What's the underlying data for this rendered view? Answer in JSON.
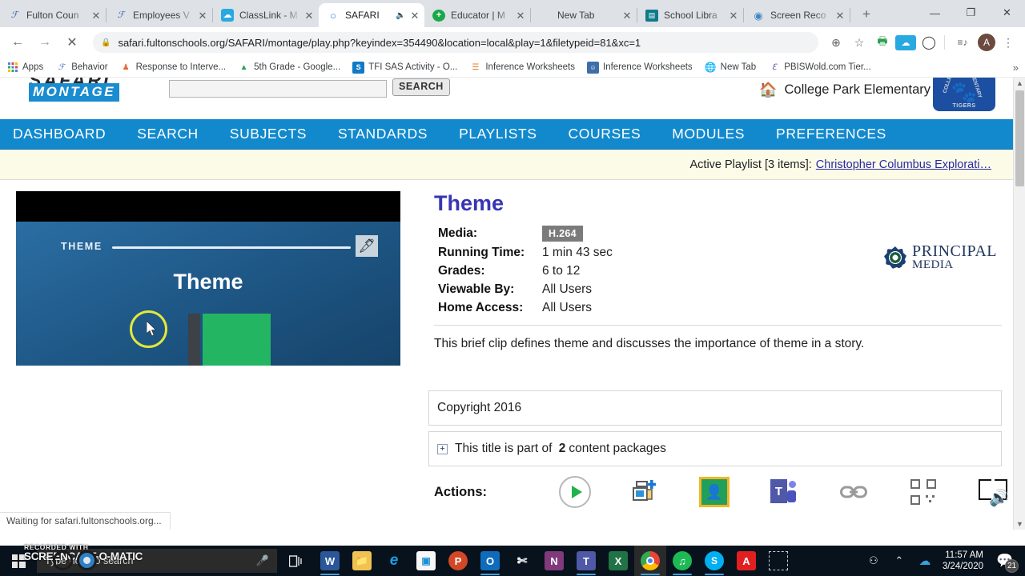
{
  "browser": {
    "tabs": [
      {
        "title": "Fulton Coun",
        "favicon": "script-F",
        "active": false,
        "audio": false
      },
      {
        "title": "Employees V",
        "favicon": "script-F",
        "active": false,
        "audio": false
      },
      {
        "title": "ClassLink - M",
        "favicon": "classlink-cloud",
        "active": false,
        "audio": false
      },
      {
        "title": "SAFARI ",
        "favicon": "loading-spinner",
        "active": true,
        "audio": true
      },
      {
        "title": "Educator | M",
        "favicon": "green-plus",
        "active": false,
        "audio": false
      },
      {
        "title": "New Tab",
        "favicon": "none",
        "active": false,
        "audio": false
      },
      {
        "title": "School Libra",
        "favicon": "ms-teal",
        "active": false,
        "audio": false
      },
      {
        "title": "Screen Reco",
        "favicon": "record-dot",
        "active": false,
        "audio": false
      }
    ],
    "new_tab_label": "+",
    "close_glyph": "✕",
    "window_controls": {
      "minimize": "—",
      "maximize": "❐",
      "close": "✕"
    },
    "nav": {
      "back": "←",
      "forward": "→",
      "stop": "✕"
    },
    "omnibox": {
      "lock": "🔒",
      "url": "safari.fultonschools.org/SAFARI/montage/play.php?keyindex=354490&location=local&play=1&filetypeid=81&xc=1"
    },
    "toolbar_icons": [
      {
        "name": "zoom-icon",
        "glyph": "⊕"
      },
      {
        "name": "bookmark-star-icon",
        "glyph": "☆"
      },
      {
        "name": "print-add-icon",
        "glyph": "🖨"
      },
      {
        "name": "classlink-extension-icon",
        "glyph": "☁"
      },
      {
        "name": "opera-extension-icon",
        "glyph": "◯"
      },
      {
        "name": "media-list-icon",
        "glyph": "≡♪"
      }
    ],
    "profile_initial": "A",
    "menu_glyph": "⋮",
    "bookmarks": [
      {
        "label": "Apps",
        "icon": "apps-grid-icon"
      },
      {
        "label": "Behavior",
        "icon": "script-f-icon"
      },
      {
        "label": "Response to Interve...",
        "icon": "person-pin-icon"
      },
      {
        "label": "5th Grade - Google...",
        "icon": "google-drive-icon"
      },
      {
        "label": "TFI SAS Activity - O...",
        "icon": "sharepoint-icon"
      },
      {
        "label": "Inference Worksheets",
        "icon": "orange-lines-icon"
      },
      {
        "label": "Inference Worksheets",
        "icon": "photo-icon"
      },
      {
        "label": "New Tab",
        "icon": "globe-icon"
      },
      {
        "label": "PBISWold.com Tier...",
        "icon": "script-e-icon"
      }
    ],
    "bookmarks_overflow": "»",
    "status_text": "Waiting for safari.fultonschools.org..."
  },
  "site": {
    "logo": {
      "line1": "SAFARI",
      "line2": "MONTAGE"
    },
    "search": {
      "value": "",
      "placeholder": "",
      "button_label": "SEARCH"
    },
    "school_name": "College Park Elementary",
    "crest": {
      "left": "COLLEGE",
      "right": "ELEMENTARY",
      "bottom": "TIGERS",
      "paw": "🐾"
    },
    "nav_items": [
      "DASHBOARD",
      "SEARCH",
      "SUBJECTS",
      "STANDARDS",
      "PLAYLISTS",
      "COURSES",
      "MODULES",
      "PREFERENCES"
    ],
    "playlist_bar": {
      "label": "Active Playlist [3 items]:",
      "link": "Christopher Columbus Explorati…"
    }
  },
  "player": {
    "overlay_label": "THEME",
    "slide_title": "Theme",
    "quill_glyph": "🖋"
  },
  "details": {
    "title": "Theme",
    "meta": [
      {
        "key": "Media:",
        "value": "H.264",
        "badge": true
      },
      {
        "key": "Running Time:",
        "value": "1 min 43 sec",
        "badge": false
      },
      {
        "key": "Grades:",
        "value": "6 to 12",
        "badge": false
      },
      {
        "key": "Viewable By:",
        "value": "All Users",
        "badge": false
      },
      {
        "key": "Home Access:",
        "value": "All Users",
        "badge": false
      }
    ],
    "publisher": {
      "line1": "PRINCIPAL",
      "line2": "MEDIA"
    },
    "description": "This brief clip defines theme and discusses the importance of theme in a story.",
    "copyright": "Copyright 2016",
    "packages": {
      "toggle": "+",
      "prefix": "This title is part of",
      "count": "2",
      "suffix": "content packages"
    },
    "actions": {
      "label": "Actions:",
      "items": [
        {
          "name": "play-action-icon",
          "title": "Play"
        },
        {
          "name": "add-to-playlist-icon",
          "title": "Add to Playlist"
        },
        {
          "name": "google-classroom-icon",
          "title": "Google Classroom"
        },
        {
          "name": "microsoft-teams-icon",
          "title": "Microsoft Teams"
        },
        {
          "name": "copy-link-icon",
          "title": "Copy Link"
        },
        {
          "name": "qr-code-icon",
          "title": "QR Code"
        },
        {
          "name": "read-aloud-icon",
          "title": "Read Aloud"
        }
      ]
    }
  },
  "watermark": {
    "line1": "RECORDED WITH",
    "line2": "SCREENCAST-O-MATIC"
  },
  "taskbar": {
    "search_placeholder": "Type here to search",
    "mic_glyph": "🎤",
    "taskview_glyph": "❏",
    "apps": [
      {
        "name": "word-taskbar-icon",
        "letter": "W",
        "color": "#2b579a"
      },
      {
        "name": "file-explorer-taskbar-icon",
        "letter": "",
        "color": "#ffc95c"
      },
      {
        "name": "internet-explorer-taskbar-icon",
        "letter": "e",
        "color": "#1ba1e2"
      },
      {
        "name": "microsoft-store-taskbar-icon",
        "letter": "",
        "color": "#f4f4f4"
      },
      {
        "name": "powerpoint-taskbar-icon",
        "letter": "P",
        "color": "#d24726"
      },
      {
        "name": "outlook-taskbar-icon",
        "letter": "O",
        "color": "#0072c6"
      },
      {
        "name": "snipping-tool-taskbar-icon",
        "letter": "",
        "color": "#dedede"
      },
      {
        "name": "onenote-taskbar-icon",
        "letter": "N",
        "color": "#80397b"
      },
      {
        "name": "teams-taskbar-icon",
        "letter": "T",
        "color": "#5058a8"
      },
      {
        "name": "excel-taskbar-icon",
        "letter": "X",
        "color": "#217346"
      },
      {
        "name": "chrome-taskbar-icon",
        "letter": "",
        "color": "#4285f4"
      },
      {
        "name": "spotify-taskbar-icon",
        "letter": "",
        "color": "#1db954"
      },
      {
        "name": "skype-taskbar-icon",
        "letter": "S",
        "color": "#00aff0"
      },
      {
        "name": "adobe-reader-taskbar-icon",
        "letter": "A",
        "color": "#e02020"
      },
      {
        "name": "snip-sketch-taskbar-icon",
        "letter": "",
        "color": "#07121c"
      }
    ],
    "tray": [
      {
        "name": "people-tray-icon",
        "glyph": "⚇"
      },
      {
        "name": "show-hidden-icons-chevron",
        "glyph": "⌃"
      },
      {
        "name": "onedrive-tray-icon",
        "glyph": "☁"
      }
    ],
    "time": "11:57 AM",
    "date": "3/24/2020",
    "notification_count": "21",
    "notification_glyph": "🗩"
  },
  "colors": {
    "nav_blue": "#1289cd",
    "title_purple": "#3735b4",
    "playlist_bg": "#fbfbe8",
    "link_blue": "#2a2aa5",
    "taskbar_bg": "#07121c"
  }
}
